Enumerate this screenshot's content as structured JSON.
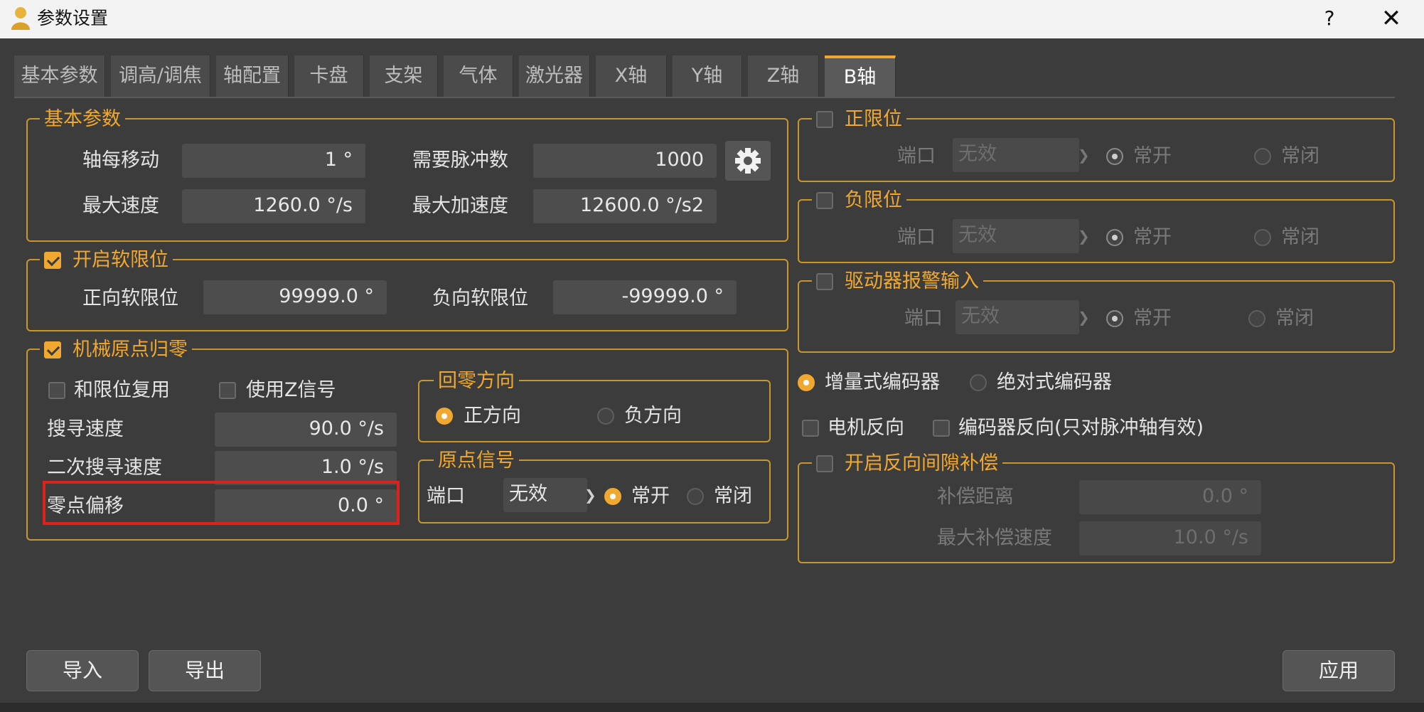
{
  "window": {
    "title": "参数设置",
    "help": "?",
    "close": "✕"
  },
  "tabs": [
    "基本参数",
    "调高/调焦",
    "轴配置",
    "卡盘",
    "支架",
    "气体",
    "激光器",
    "X轴",
    "Y轴",
    "Z轴",
    "B轴"
  ],
  "basic": {
    "legend": "基本参数",
    "move_label": "轴每移动",
    "move_value": "1 °",
    "pulse_label": "需要脉冲数",
    "pulse_value": "1000",
    "max_speed_label": "最大速度",
    "max_speed_value": "1260.0 °/s",
    "max_acc_label": "最大加速度",
    "max_acc_value": "12600.0 °/s2"
  },
  "soft_limit": {
    "legend": "开启软限位",
    "pos_label": "正向软限位",
    "pos_value": "99999.0 °",
    "neg_label": "负向软限位",
    "neg_value": "-99999.0 °"
  },
  "homing": {
    "legend": "机械原点归零",
    "reuse_limit": "和限位复用",
    "use_z": "使用Z信号",
    "search_speed_label": "搜寻速度",
    "search_speed_value": "90.0 °/s",
    "second_speed_label": "二次搜寻速度",
    "second_speed_value": "1.0 °/s",
    "offset_label": "零点偏移",
    "offset_value": "0.0 °",
    "direction": {
      "legend": "回零方向",
      "positive": "正方向",
      "negative": "负方向"
    },
    "origin": {
      "legend": "原点信号",
      "port_label": "端口",
      "port_value": "无效",
      "no": "常开",
      "nc": "常闭"
    }
  },
  "pos_limit": {
    "legend": "正限位",
    "port_label": "端口",
    "port_value": "无效",
    "no": "常开",
    "nc": "常闭"
  },
  "neg_limit": {
    "legend": "负限位",
    "port_label": "端口",
    "port_value": "无效",
    "no": "常开",
    "nc": "常闭"
  },
  "alarm": {
    "legend": "驱动器报警输入",
    "port_label": "端口",
    "port_value": "无效",
    "no": "常开",
    "nc": "常闭"
  },
  "encoder": {
    "incremental": "增量式编码器",
    "absolute": "绝对式编码器",
    "motor_reverse": "电机反向",
    "encoder_reverse": "编码器反向(只对脉冲轴有效)"
  },
  "backlash": {
    "legend": "开启反向间隙补偿",
    "distance_label": "补偿距离",
    "distance_value": "0.0 °",
    "speed_label": "最大补偿速度",
    "speed_value": "10.0 °/s"
  },
  "buttons": {
    "import": "导入",
    "export": "导出",
    "apply": "应用"
  }
}
